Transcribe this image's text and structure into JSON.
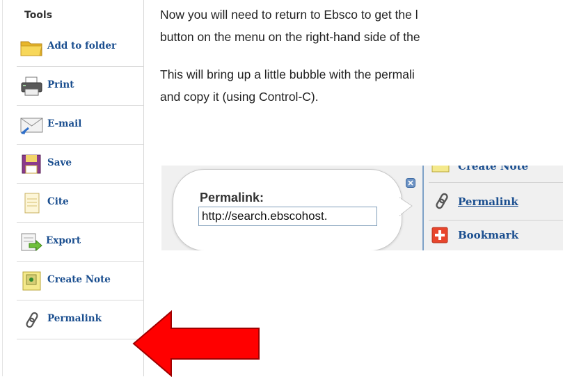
{
  "sidebar": {
    "title": "Tools",
    "items": [
      {
        "label": "Add to folder",
        "icon": "folder-icon"
      },
      {
        "label": "Print",
        "icon": "printer-icon"
      },
      {
        "label": "E-mail",
        "icon": "envelope-icon"
      },
      {
        "label": "Save",
        "icon": "floppy-disk-icon"
      },
      {
        "label": "Cite",
        "icon": "document-icon"
      },
      {
        "label": "Export",
        "icon": "export-icon"
      },
      {
        "label": "Create Note",
        "icon": "note-icon"
      },
      {
        "label": "Permalink",
        "icon": "chain-link-icon"
      }
    ]
  },
  "instructions": {
    "line1": "Now you will need to return to Ebsco to get the l",
    "line2": "button on the menu on the right-hand side of the",
    "line3": "This will bring up a little bubble with the permali",
    "line4": "and copy it (using Control-C)."
  },
  "bubble": {
    "label": "Permalink:",
    "url_value": "http://search.ebscohost.",
    "close_icon": "close-icon"
  },
  "panel_tools": {
    "create_note": "Create Note",
    "permalink": "Permalink",
    "bookmark": "Bookmark"
  },
  "colors": {
    "link": "#1a4e8f",
    "arrow_fill": "#ff0000",
    "arrow_stroke": "#a00000"
  },
  "annotation": {
    "arrow": "red-arrow-pointing-left"
  }
}
